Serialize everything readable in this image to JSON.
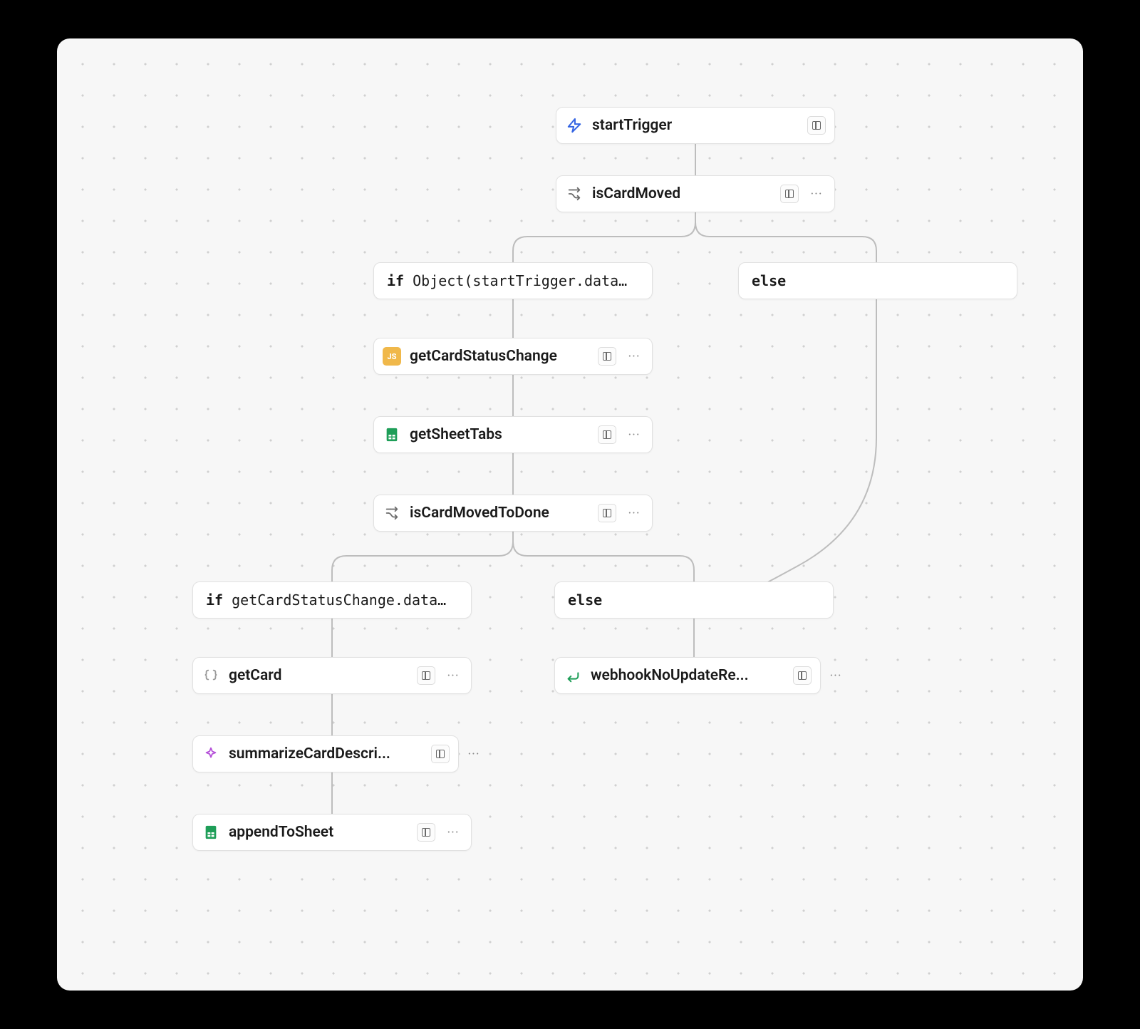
{
  "nodes": {
    "startTrigger": {
      "label": "startTrigger",
      "icon": "bolt",
      "color": "#3565e3"
    },
    "isCardMoved": {
      "label": "isCardMoved",
      "icon": "branch",
      "color": "#6b6b6b"
    },
    "getCardStatusChange": {
      "label": "getCardStatusChange",
      "icon": "js",
      "color": "#f0b84a"
    },
    "getSheetTabs": {
      "label": "getSheetTabs",
      "icon": "sheet",
      "color": "#1e9e58"
    },
    "isCardMovedToDone": {
      "label": "isCardMovedToDone",
      "icon": "branch",
      "color": "#6b6b6b"
    },
    "getCard": {
      "label": "getCard",
      "icon": "braces",
      "color": "#9a9a9a"
    },
    "summarizeCardDescri": {
      "label": "summarizeCardDescri...",
      "icon": "sparkle",
      "color": "#b44fd8"
    },
    "appendToSheet": {
      "label": "appendToSheet",
      "icon": "sheet",
      "color": "#1e9e58"
    },
    "webhookNoUpdateRe": {
      "label": "webhookNoUpdateRe...",
      "icon": "return",
      "color": "#1e9e58"
    }
  },
  "conditions": {
    "cond1_if": {
      "kw": "if",
      "expr": "Object(startTrigger.data…"
    },
    "cond1_else": {
      "kw": "else",
      "expr": ""
    },
    "cond2_if": {
      "kw": "if",
      "expr": "getCardStatusChange.data…"
    },
    "cond2_else": {
      "kw": "else",
      "expr": ""
    }
  },
  "icons": {
    "more": "···"
  }
}
